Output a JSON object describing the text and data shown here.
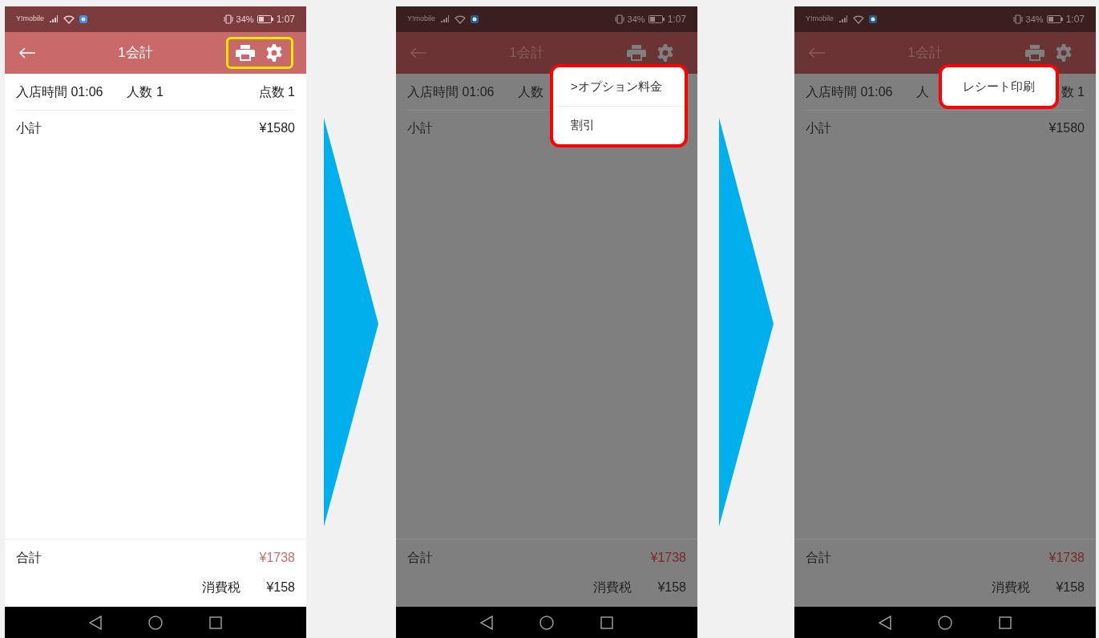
{
  "screens": [
    {
      "status": {
        "carrier": "Y!mobile",
        "battery": "34%",
        "time": "1:07"
      },
      "title": "1会計",
      "dimmed": false,
      "icons_highlighted": true,
      "info": {
        "time": "入店時間 01:06",
        "people": "人数 1",
        "points": "点数 1"
      },
      "subtotal": {
        "label": "小計",
        "value": "¥1580"
      },
      "total": {
        "label": "合計",
        "value": "¥1738"
      },
      "tax": {
        "label": "消費税",
        "value": "¥158"
      }
    },
    {
      "status": {
        "carrier": "Y!mobile",
        "battery": "34%",
        "time": "1:07"
      },
      "title": "1会計",
      "dimmed": true,
      "icons_highlighted": false,
      "info": {
        "time": "入店時間 01:06",
        "people": "人数"
      },
      "subtotal": {
        "label": "小計"
      },
      "total": {
        "label": "合計",
        "value": "¥1738"
      },
      "tax": {
        "label": "消費税",
        "value": "¥158"
      },
      "menu": {
        "highlighted": true,
        "items": [
          ">オプション料金",
          "割引"
        ]
      }
    },
    {
      "status": {
        "carrier": "Y!mobile",
        "battery": "34%",
        "time": "1:07"
      },
      "title": "1会計",
      "dimmed": true,
      "icons_highlighted": false,
      "info": {
        "time": "入店時間 01:06",
        "people": "人",
        "points": "数 1"
      },
      "subtotal": {
        "label": "小計",
        "value": "¥1580"
      },
      "total": {
        "label": "合計",
        "value": "¥1738"
      },
      "tax": {
        "label": "消費税",
        "value": "¥158"
      },
      "menu": {
        "highlighted": true,
        "items": [
          "レシート印刷"
        ]
      }
    }
  ]
}
